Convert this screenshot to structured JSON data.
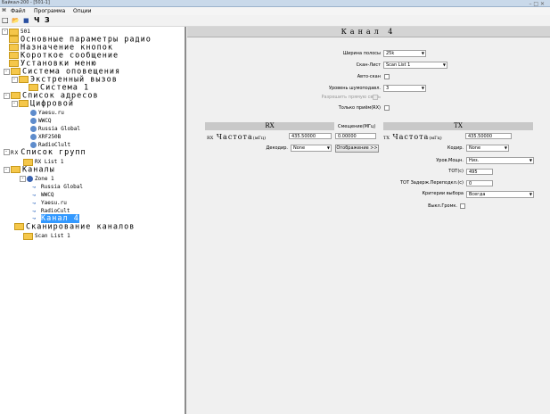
{
  "window": {
    "title": "Байкал-200 - [501-1]",
    "controls": "–  □  ✕"
  },
  "menu": {
    "file": "Файл",
    "program": "Программа",
    "options": "Опции"
  },
  "toolbar": {
    "new": "□",
    "open": "📂",
    "save": "■",
    "read": "Ч",
    "write": "З"
  },
  "tree": {
    "root": "501",
    "main_params": "Основные параметры радио",
    "key_assign": "Назначение кнопок",
    "short_msg": "Короткое сообщение",
    "menu_settings": "Установки меню",
    "alert_system": "Система оповещения",
    "emergency": "Экстренный вызов",
    "system1": "Система 1",
    "addr_list": "Список адресов",
    "digital": "Цифровой",
    "contacts": [
      "Yaesu.ru",
      "WWCQ",
      "Russia Global",
      "XRF250B",
      "RadioClult"
    ],
    "group_list": "Список групп",
    "rx_list": "RX List 1",
    "channels": "Каналы",
    "zone": "Zone 1",
    "zone_channels": [
      "Russia Global",
      "WWCQ",
      "Yaesu.ru",
      "RadioCult"
    ],
    "selected_channel": "Канал 4",
    "scan": "Сканирование каналов",
    "scan_list": "Scan List 1"
  },
  "main": {
    "header": "Канал 4",
    "bandwidth": {
      "label": "Ширина полосы",
      "value": "25k"
    },
    "scan_list": {
      "label": "Скан-Лист",
      "value": "Scan List 1"
    },
    "auto_scan": {
      "label": "Авто-скан"
    },
    "squelch": {
      "label": "Уровень шумоподавл.",
      "value": "3"
    },
    "allow_talkaround": {
      "label": "Разрешить прямую связь"
    },
    "rx_only": {
      "label": "Только приём(RX)"
    },
    "rx_header": "RX",
    "tx_header": "TX",
    "rx_freq": {
      "label": "Частота",
      "unit": "(мГц)",
      "prefix": "RX",
      "value": "435.50000"
    },
    "offset": {
      "label": "Смещение(МГц)",
      "value": "0.00000"
    },
    "tx_freq": {
      "label": "Частота",
      "unit": "(мГц)",
      "prefix": "TX",
      "value": "435.50000"
    },
    "decoder": {
      "label": "Декодир.",
      "value": "None"
    },
    "encoder": {
      "label": "Кодир.",
      "value": "None"
    },
    "reverse_btn": "Отображение >>",
    "power": {
      "label": "Уров.Мощн.",
      "value": "Низ."
    },
    "tot": {
      "label": "TOT(с)",
      "value": "495"
    },
    "tot_rekey": {
      "label": "TOT Задерж.Переподкл.(с)",
      "value": "0"
    },
    "admit": {
      "label": "Критерии выбора",
      "value": "Всегда"
    },
    "vox": {
      "label": "Выкл.Громк."
    }
  }
}
